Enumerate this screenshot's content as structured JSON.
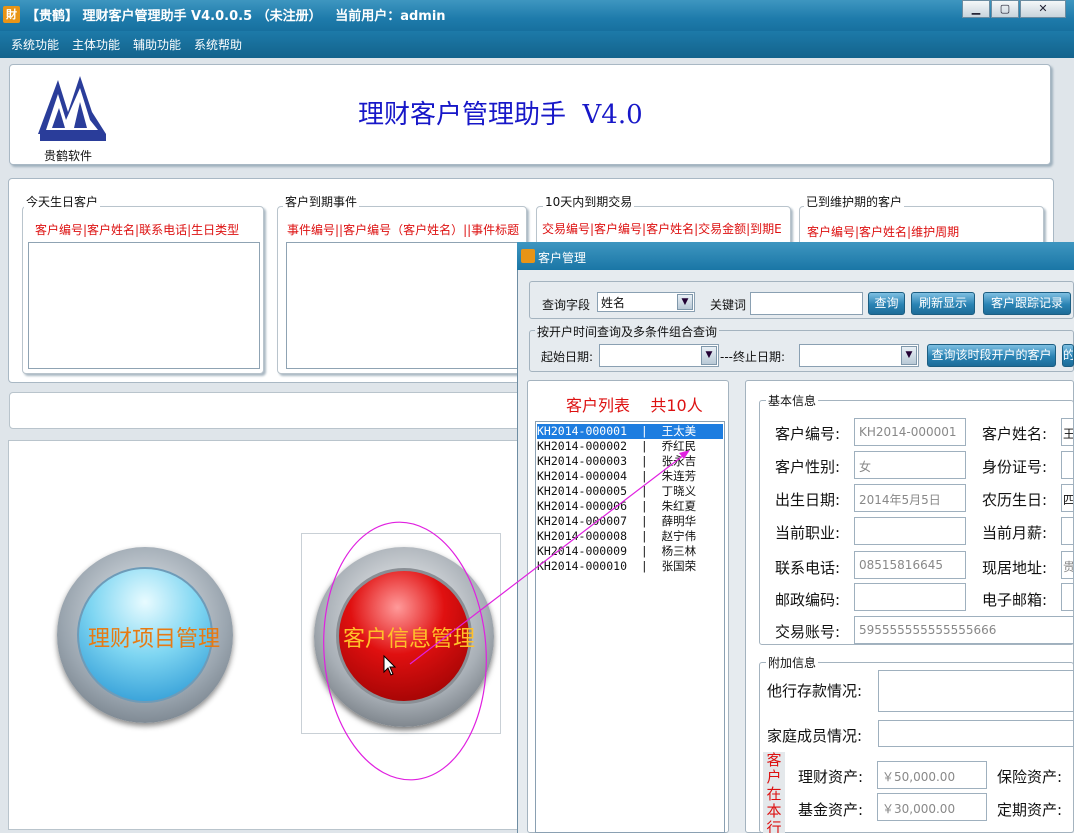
{
  "window": {
    "title": "【贵鹤】 理财客户管理助手 V4.0.0.5 （未注册）   当前用户：admin",
    "icon": "app-icon-cai",
    "controls": [
      "minimize",
      "maximize",
      "close"
    ]
  },
  "menu": [
    "系统功能",
    "主体功能",
    "辅助功能",
    "系统帮助"
  ],
  "banner": {
    "logo_caption": "贵鹤软件",
    "heading": "理财客户管理助手  V4.0"
  },
  "panels": [
    {
      "title": "今天生日客户",
      "columns": "客户编号|客户姓名|联系电话|生日类型"
    },
    {
      "title": "客户到期事件",
      "columns": "事件编号||客户编号（客户姓名）||事件标题"
    },
    {
      "title": "10天内到期交易",
      "columns": "交易编号|客户编号|客户姓名|交易金额|到期E"
    },
    {
      "title": "已到维护期的客户",
      "columns": "客户编号|客户姓名|维护周期"
    }
  ],
  "orbs": {
    "blue": "理财项目管理",
    "red": "客户信息管理"
  },
  "customer_window": {
    "title": "客户管理",
    "search": {
      "field_label": "查询字段",
      "field_value": "姓名",
      "keyword_label": "关键词",
      "keyword_value": "",
      "query_button": "查询",
      "refresh_button": "刷新显示",
      "followup_button": "客户跟踪记录"
    },
    "date_query": {
      "legend": "按开户时间查询及多条件组合查询",
      "start_label": "起始日期:",
      "end_label": "---终止日期:",
      "query_button": "查询该时段开户的客户",
      "more_button": "的"
    },
    "list": {
      "title": "客户列表    共10人",
      "rows": [
        {
          "id": "KH2014-000001",
          "name": "王太美"
        },
        {
          "id": "KH2014-000002",
          "name": "乔红民"
        },
        {
          "id": "KH2014-000003",
          "name": "张永吉"
        },
        {
          "id": "KH2014-000004",
          "name": "朱连芳"
        },
        {
          "id": "KH2014-000005",
          "name": "丁晓义"
        },
        {
          "id": "KH2014-000006",
          "name": "朱红夏"
        },
        {
          "id": "KH2014-000007",
          "name": "薛明华"
        },
        {
          "id": "KH2014-000008",
          "name": "赵宁伟"
        },
        {
          "id": "KH2014-000009",
          "name": "杨三林"
        },
        {
          "id": "KH2014-000010",
          "name": "张国荣"
        }
      ],
      "selected_index": 0
    },
    "basic": {
      "legend": "基本信息",
      "customer_id_label": "客户编号:",
      "customer_id": "KH2014-000001",
      "name_label": "客户姓名:",
      "name_value": "王",
      "gender_label": "客户性别:",
      "gender": "女",
      "idcard_label": "身份证号:",
      "birth_label": "出生日期:",
      "birth": "2014年5月5日",
      "lunar_label": "农历生日:",
      "lunar_value": "四",
      "job_label": "当前职业:",
      "salary_label": "当前月薪:",
      "phone_label": "联系电话:",
      "phone": "08515816645",
      "address_label": "现居地址:",
      "address_value": "贵",
      "zip_label": "邮政编码:",
      "email_label": "电子邮箱:",
      "account_label": "交易账号:",
      "account": "595555555555555666"
    },
    "extra": {
      "legend": "附加信息",
      "other_bank_label": "他行存款情况:",
      "family_label": "家庭成员情况:",
      "vertical_label": "客户在本行",
      "wealth_label": "理财资产:",
      "wealth": "￥50,000.00",
      "insurance_label": "保险资产:",
      "fund_label": "基金资产:",
      "fund": "￥30,000.00",
      "fixed_label": "定期资产:"
    }
  },
  "colors": {
    "title_blue": "#1e7bab",
    "heading_blue": "#1717c8",
    "column_red": "#dd1111",
    "orb_label_orange": "#e77a13",
    "orb_label_yellow": "#ffc02a",
    "annotation_magenta": "#e020e0"
  }
}
